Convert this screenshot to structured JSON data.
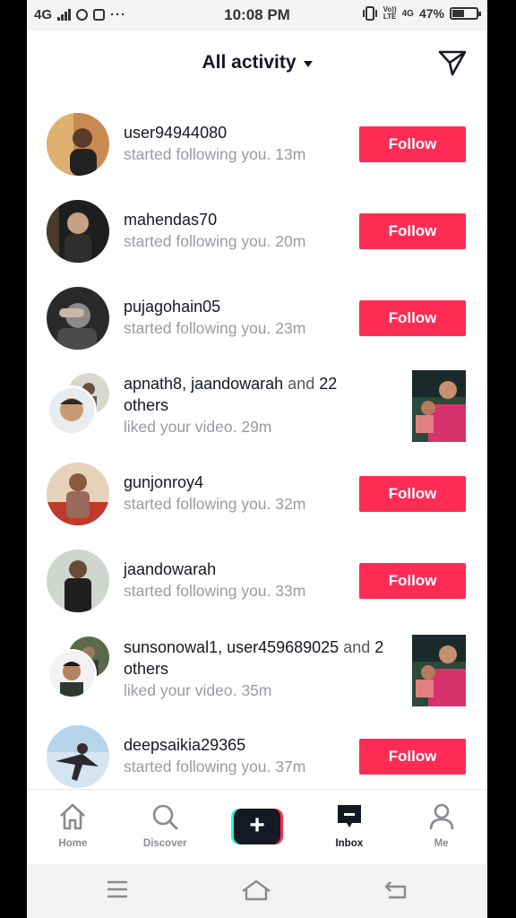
{
  "status_bar": {
    "network": "4G",
    "time": "10:08 PM",
    "volte": "Vo))",
    "lte": "LTE",
    "network_right": "4G",
    "battery": "47%",
    "battery_level": 0.47,
    "more": "···"
  },
  "header": {
    "title": "All activity"
  },
  "activity": [
    {
      "user": "user94944080",
      "sub": "started following you.",
      "time": "13m",
      "action": "Follow",
      "kind": "follow"
    },
    {
      "user": "mahendas70",
      "sub": "started following you.",
      "time": "20m",
      "action": "Follow",
      "kind": "follow"
    },
    {
      "user": "pujagohain05",
      "sub": "started following you.",
      "time": "23m",
      "action": "Follow",
      "kind": "follow"
    },
    {
      "user": "apnath8, jaandowarah",
      "and": "and",
      "count": "22 others",
      "sub": "liked your video.",
      "time": "29m",
      "kind": "like"
    },
    {
      "user": "gunjonroy4",
      "sub": "started following you.",
      "time": "32m",
      "action": "Follow",
      "kind": "follow"
    },
    {
      "user": "jaandowarah",
      "sub": "started following you.",
      "time": "33m",
      "action": "Follow",
      "kind": "follow"
    },
    {
      "user": "sunsonowal1, user459689025",
      "and": "and",
      "count": "2 others",
      "sub": "liked your video.",
      "time": "35m",
      "kind": "like"
    },
    {
      "user": "deepsaikia29365",
      "sub": "started following you.",
      "time": "37m",
      "action": "Follow",
      "kind": "follow"
    }
  ],
  "tabbar": {
    "home": "Home",
    "discover": "Discover",
    "create": "+",
    "inbox": "Inbox",
    "me": "Me"
  },
  "colors": {
    "accent": "#fe2c55",
    "cyan": "#25f4ee",
    "text": "#161823",
    "muted": "#9a9ba1"
  }
}
